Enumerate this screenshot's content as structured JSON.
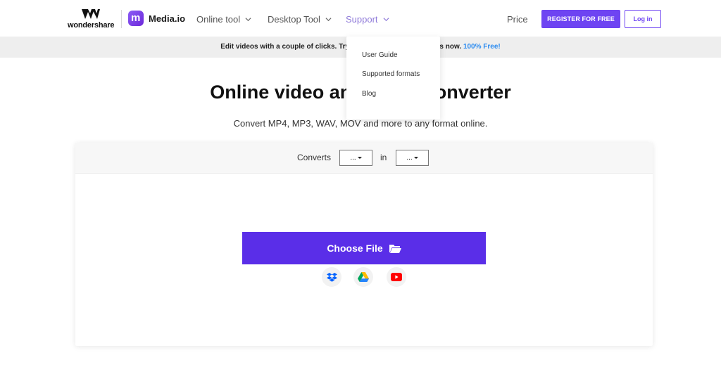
{
  "header": {
    "brand_wordmark": "wondershare",
    "product_name": "Media.io",
    "product_badge_letter": "m",
    "nav": {
      "online_tool": "Online tool",
      "desktop_tool": "Desktop Tool",
      "support": "Support",
      "price": "Price"
    },
    "register_label": "REGISTER FOR FREE",
    "login_label": "Log in"
  },
  "support_menu": {
    "items": [
      "User Guide",
      "Supported formats",
      "Blog"
    ]
  },
  "banner": {
    "text_before": "Edit videos with a couple of clicks. Try Media.io video editing tools now.",
    "highlight": "100% Free!"
  },
  "hero": {
    "title": "Online video and audio converter",
    "subtitle": "Convert MP4, MP3, WAV, MOV and more to any format online."
  },
  "converter": {
    "converts_label": "Converts",
    "in_label": "in",
    "from_value": "...",
    "to_value": "...",
    "choose_file_label": "Choose File",
    "sources": [
      "dropbox-icon",
      "google-drive-icon",
      "youtube-icon"
    ]
  },
  "colors": {
    "accent": "#6e44f2",
    "choose_button": "#5a2ee8",
    "banner_bg": "#eeeeee",
    "support_active": "#8f7ad9",
    "highlight_link": "#2d8cf0"
  }
}
